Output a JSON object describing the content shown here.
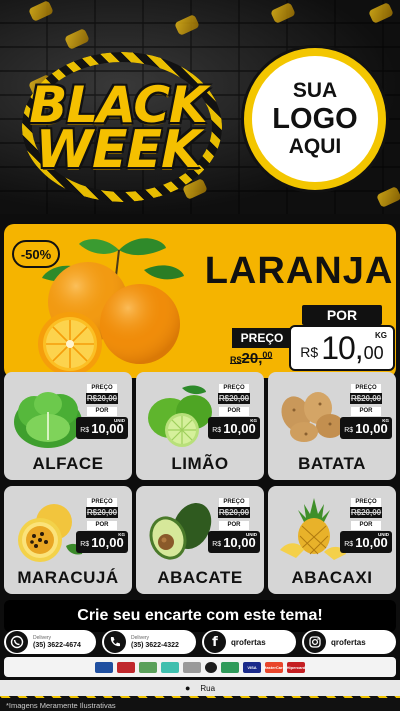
{
  "header": {
    "title_line1": "BLACK",
    "title_line2": "WEEK",
    "logo_placeholder": {
      "line1": "SUA",
      "line2": "LOGO",
      "line3": "AQUI"
    }
  },
  "hero": {
    "discount": "-50%",
    "product": "LARANJA",
    "por_label": "POR",
    "preco_label": "PREÇO",
    "old_currency": "R$",
    "old_int": "20",
    "old_dec": "00",
    "currency": "R$",
    "price_int": "10",
    "price_dec": "00",
    "unit": "KG"
  },
  "products": [
    {
      "name": "ALFACE",
      "unit": "UNID",
      "preco_label": "PREÇO",
      "por_label": "POR",
      "old_price": "R$20,00",
      "currency": "R$",
      "price": "10,00"
    },
    {
      "name": "LIMÃO",
      "unit": "KG",
      "preco_label": "PREÇO",
      "por_label": "POR",
      "old_price": "R$20,00",
      "currency": "R$",
      "price": "10,00"
    },
    {
      "name": "BATATA",
      "unit": "KG",
      "preco_label": "PREÇO",
      "por_label": "POR",
      "old_price": "R$20,00",
      "currency": "R$",
      "price": "10,00"
    },
    {
      "name": "MARACUJÁ",
      "unit": "KG",
      "preco_label": "PREÇO",
      "por_label": "POR",
      "old_price": "R$20,00",
      "currency": "R$",
      "price": "10,00"
    },
    {
      "name": "ABACATE",
      "unit": "UNID",
      "preco_label": "PREÇO",
      "por_label": "POR",
      "old_price": "R$20,00",
      "currency": "R$",
      "price": "10,00"
    },
    {
      "name": "ABACAXI",
      "unit": "UNID",
      "preco_label": "PREÇO",
      "por_label": "POR",
      "old_price": "R$20,00",
      "currency": "R$",
      "price": "10,00"
    }
  ],
  "cta": "Crie seu encarte com este tema!",
  "contacts": {
    "whatsapp": {
      "label": "Delivery",
      "number": "(35) 3622-4674"
    },
    "phone": {
      "label": "Delivery",
      "number": "(35) 3622-4322"
    },
    "facebook": "qrofertas",
    "instagram": "qrofertas"
  },
  "payments": [
    "card",
    "card",
    "cash",
    "pix",
    "ticket",
    "alelo",
    "vr",
    "VISA",
    "MasterCard",
    "Hipercard"
  ],
  "address": "Rua",
  "disclaimer": "*Imagens Meramente Ilustrativas",
  "colors": {
    "accent": "#f5b400",
    "dark": "#111111",
    "card": "#d6d6d6"
  }
}
